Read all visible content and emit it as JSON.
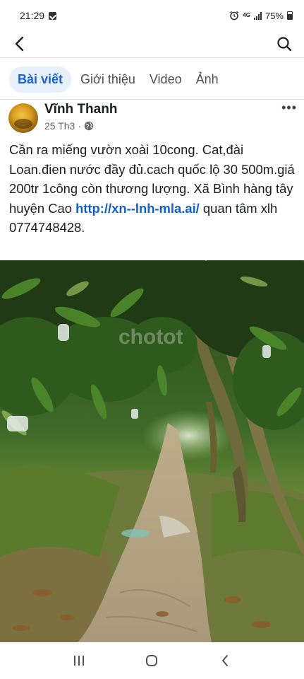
{
  "status_bar": {
    "time": "21:29",
    "battery": "75%",
    "network": "4G"
  },
  "header": {
    "back_icon": "chevron-left-icon",
    "search_icon": "search-icon"
  },
  "tabs": [
    {
      "label": "Bài viết",
      "active": true
    },
    {
      "label": "Giới thiệu",
      "active": false
    },
    {
      "label": "Video",
      "active": false
    },
    {
      "label": "Ảnh",
      "active": false
    }
  ],
  "post": {
    "author": "Vĩnh Thanh",
    "date": "25 Th3",
    "separator": "·",
    "more": "•••",
    "text": "Cần ra miếng vườn xoài 10cong. Cat,đài Loan.đien nước đầy đủ.cach quốc lộ 30 500m.giá 200tr 1công còn thương lượng. Xã Bình hàng tây huyện Cao ",
    "link": "http://xn--lnh-mla.ai/",
    "text_after_link": " quan tâm xlh 0774748428.",
    "photo_watermark": "chotot"
  },
  "colors": {
    "accent": "#1763cf",
    "tab_active_bg": "#e7f0fd",
    "link": "#1260c9"
  }
}
